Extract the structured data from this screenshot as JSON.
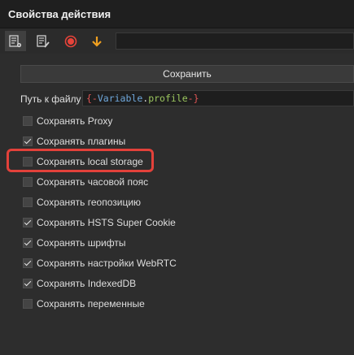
{
  "window": {
    "title": "Свойства действия"
  },
  "toolbar": {
    "buttons": [
      {
        "icon": "list-settings-icon",
        "active": true
      },
      {
        "icon": "list-edit-icon",
        "active": false
      },
      {
        "icon": "record-icon",
        "active": false
      },
      {
        "icon": "arrow-down-icon",
        "active": false
      }
    ],
    "colors": {
      "record": "#e8433a",
      "arrow": "#f0a020"
    }
  },
  "actions": {
    "save_label": "Сохранить"
  },
  "file_path": {
    "label": "Путь к файлу",
    "value": "{-Variable.profile-}",
    "parts": {
      "open": "{-",
      "variable": "Variable",
      "dot": ".",
      "property": "profile",
      "close": "-}"
    }
  },
  "options": [
    {
      "label": "Сохранять Proxy",
      "checked": false
    },
    {
      "label": "Сохранять плагины",
      "checked": true
    },
    {
      "label": "Сохранять local storage",
      "checked": false,
      "highlighted": true
    },
    {
      "label": "Сохранять часовой пояс",
      "checked": false
    },
    {
      "label": "Сохранять геопозицию",
      "checked": false
    },
    {
      "label": "Сохранять HSTS Super Cookie",
      "checked": true
    },
    {
      "label": "Сохранять шрифты",
      "checked": true
    },
    {
      "label": "Сохранять настройки WebRTC",
      "checked": true
    },
    {
      "label": "Сохранять IndexedDB",
      "checked": true
    },
    {
      "label": "Сохранять переменные",
      "checked": false
    }
  ],
  "highlight_color": "#e3413a"
}
